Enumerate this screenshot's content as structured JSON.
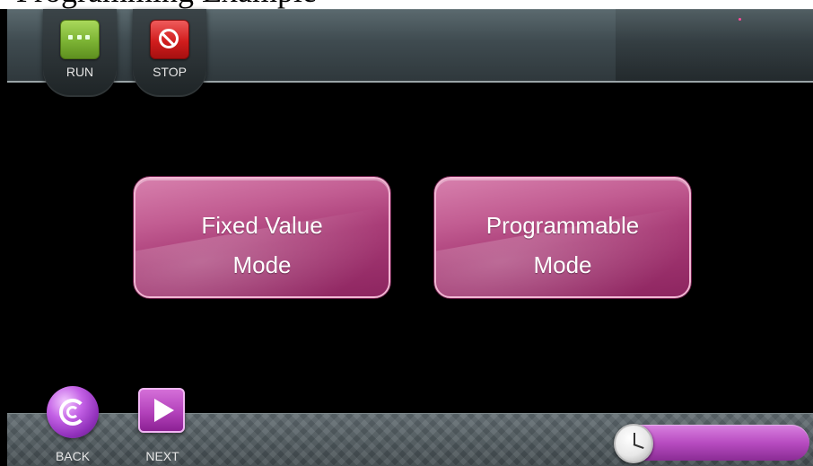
{
  "page_header_text": "Programming Example",
  "toolbar": {
    "run_label": "RUN",
    "stop_label": "STOP"
  },
  "modes": {
    "fixed_label": "Fixed Value\nMode",
    "programmable_label": "Programmable\nMode"
  },
  "nav": {
    "back_label": "BACK",
    "next_label": "NEXT"
  },
  "colors": {
    "accent_magenta": "#a83b76",
    "run_green": "#7cb334",
    "stop_red": "#d11d1d"
  },
  "icons": [
    "run-icon",
    "stop-icon",
    "back-icon",
    "next-icon",
    "clock-icon"
  ]
}
